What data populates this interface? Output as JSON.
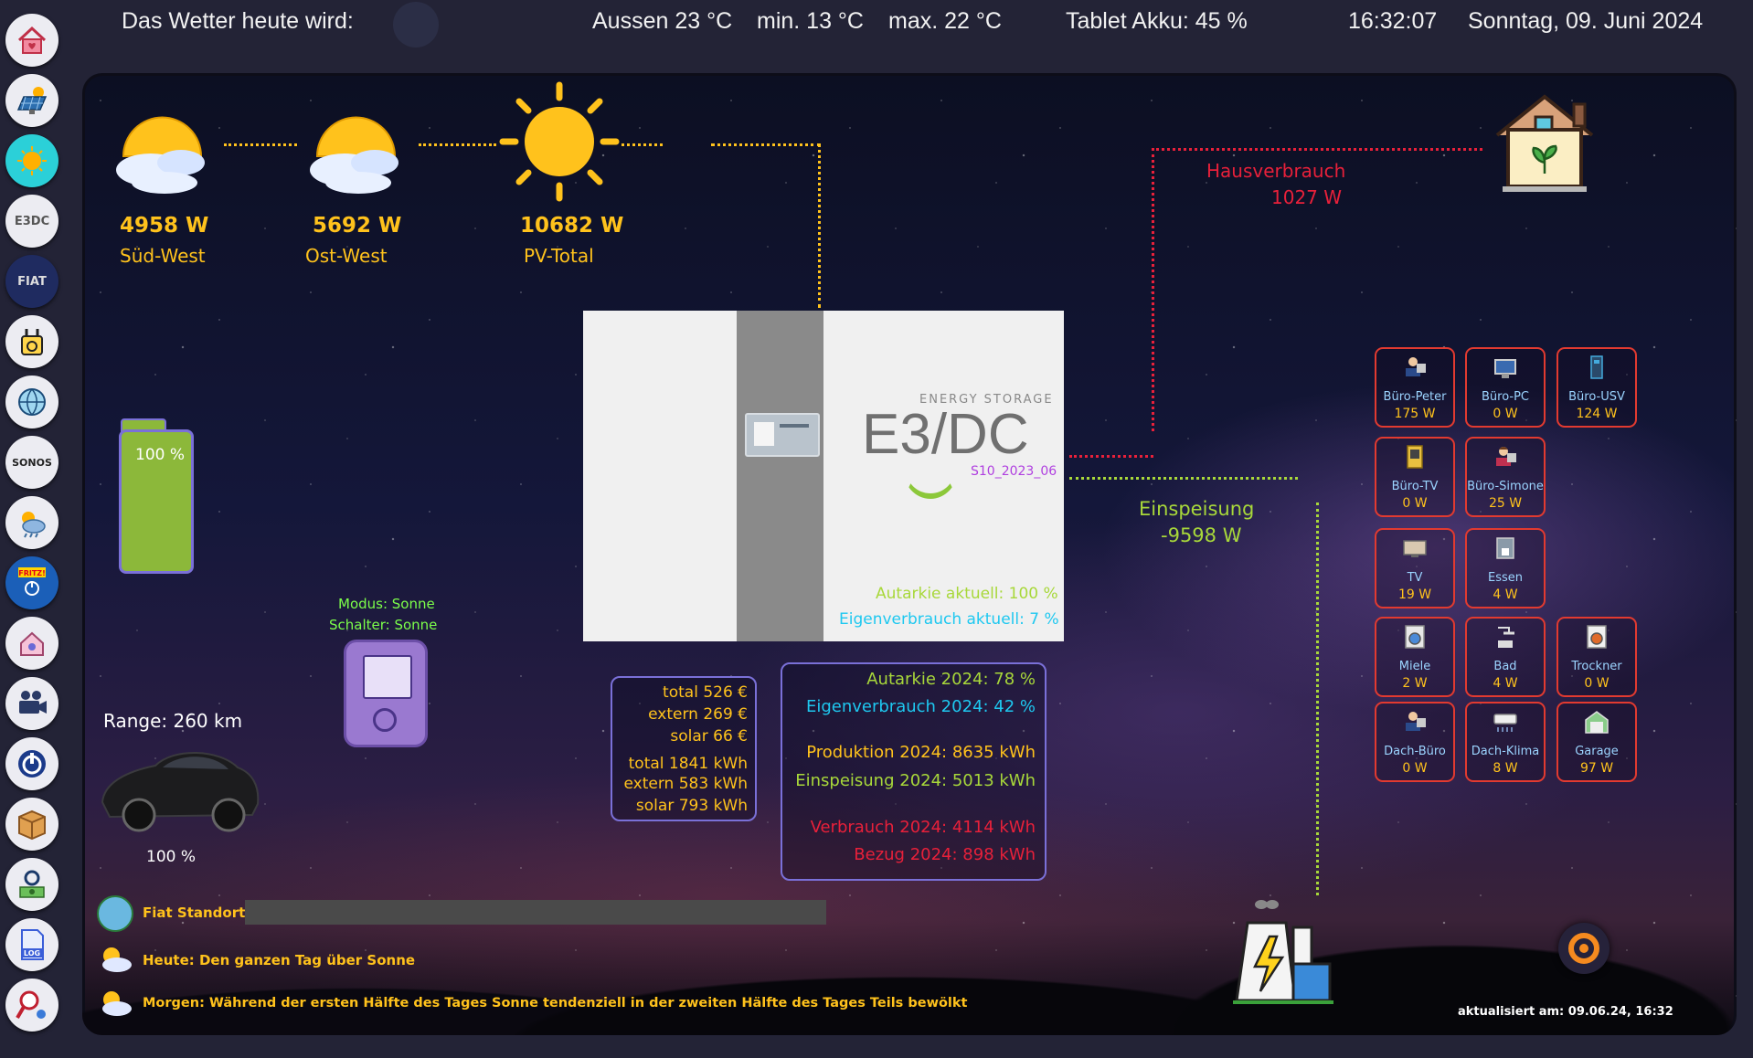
{
  "topbar": {
    "weather_label": "Das Wetter heute wird:",
    "outside": "Aussen 23 °C",
    "min": "min. 13 °C",
    "max": "max. 22 °C",
    "tablet": "Tablet Akku: 45 %",
    "time": "16:32:07",
    "date": "Sonntag, 09. Juni 2024"
  },
  "sidebar": {
    "items": [
      {
        "icon": "home-icon"
      },
      {
        "icon": "solar-panel-icon"
      },
      {
        "icon": "sun-icon"
      },
      {
        "icon": "e3dc-icon",
        "text": "E3DC"
      },
      {
        "icon": "fiat-icon",
        "text": "FIAT"
      },
      {
        "icon": "charger-icon"
      },
      {
        "icon": "network-globe-icon"
      },
      {
        "icon": "sonos-icon",
        "text": "SONOS"
      },
      {
        "icon": "weather-icon"
      },
      {
        "icon": "fritzbox-icon",
        "text": "FRITZ!"
      },
      {
        "icon": "smarthome-icon"
      },
      {
        "icon": "video-camera-icon"
      },
      {
        "icon": "power-icon"
      },
      {
        "icon": "package-icon"
      },
      {
        "icon": "settings-money-icon"
      },
      {
        "icon": "log-icon",
        "text": "LOG"
      },
      {
        "icon": "search-settings-icon"
      }
    ]
  },
  "pv": {
    "sw_value": "4958 W",
    "sw_name": "Süd-West",
    "ow_value": "5692 W",
    "ow_name": "Ost-West",
    "total_value": "10682 W",
    "total_name": "PV-Total"
  },
  "house": {
    "label": "Hausverbrauch",
    "value": "1027 W"
  },
  "battery": {
    "level": "100 %",
    "level_fraction": 1.0
  },
  "wallbox": {
    "mode": "Modus: Sonne",
    "switch": "Schalter: Sonne"
  },
  "car": {
    "range": "Range: 260 km",
    "soc": "100 %"
  },
  "e3dc": {
    "brand_top": "ENERGY STORAGE",
    "brand": "E3/DC",
    "id": "S10_2023_06",
    "autarkie": "Autarkie aktuell: 100 %",
    "eigenverbrauch": "Eigenverbrauch aktuell: 7 %"
  },
  "grid": {
    "label": "Einspeisung",
    "value": "-9598 W"
  },
  "costs": {
    "total_eur": "total 526 €",
    "extern_eur": "extern 269 €",
    "solar_eur": "solar 66 €",
    "total_kwh": "total 1841 kWh",
    "extern_kwh": "extern 583 kWh",
    "solar_kwh": "solar 793 kWh"
  },
  "year": {
    "autarkie": "Autarkie 2024: 78 %",
    "eigenverbrauch": "Eigenverbrauch 2024: 42 %",
    "produktion": "Produktion 2024: 8635 kWh",
    "einspeisung": "Einspeisung 2024: 5013 kWh",
    "verbrauch": "Verbrauch 2024: 4114 kWh",
    "bezug": "Bezug 2024: 898 kWh"
  },
  "devices": [
    {
      "name": "Büro-Peter",
      "value": "175 W",
      "icon": "person-desk-icon"
    },
    {
      "name": "Büro-PC",
      "value": "0 W",
      "icon": "pc-icon"
    },
    {
      "name": "Büro-USV",
      "value": "124 W",
      "icon": "ups-icon"
    },
    {
      "name": "Büro-TV",
      "value": "0 W",
      "icon": "tv-icon"
    },
    {
      "name": "Büro-Simone",
      "value": "25 W",
      "icon": "person-desk-icon"
    },
    {
      "name": "TV",
      "value": "19 W",
      "icon": "tv-icon"
    },
    {
      "name": "Essen",
      "value": "4 W",
      "icon": "coffee-machine-icon"
    },
    {
      "name": "Miele",
      "value": "2 W",
      "icon": "washing-machine-icon"
    },
    {
      "name": "Bad",
      "value": "4 W",
      "icon": "shower-icon"
    },
    {
      "name": "Trockner",
      "value": "0 W",
      "icon": "dryer-icon"
    },
    {
      "name": "Dach-Büro",
      "value": "0 W",
      "icon": "person-desk-icon"
    },
    {
      "name": "Dach-Klima",
      "value": "8 W",
      "icon": "air-conditioner-icon"
    },
    {
      "name": "Garage",
      "value": "97 W",
      "icon": "garage-icon"
    }
  ],
  "footer": {
    "fiat_label": "Fiat Standort:",
    "today": "Heute: Den ganzen Tag über Sonne",
    "tomorrow": "Morgen: Während der ersten Hälfte des Tages Sonne tendenziell in der zweiten Hälfte des Tages Teils bewölkt",
    "updated": "aktualisiert am: 09.06.24, 16:32"
  },
  "colors": {
    "pv": "#ffc21c",
    "house": "#e8203a",
    "grid": "#a8d83a",
    "battery": "#8cb83a",
    "accent": "#7a70d8"
  }
}
